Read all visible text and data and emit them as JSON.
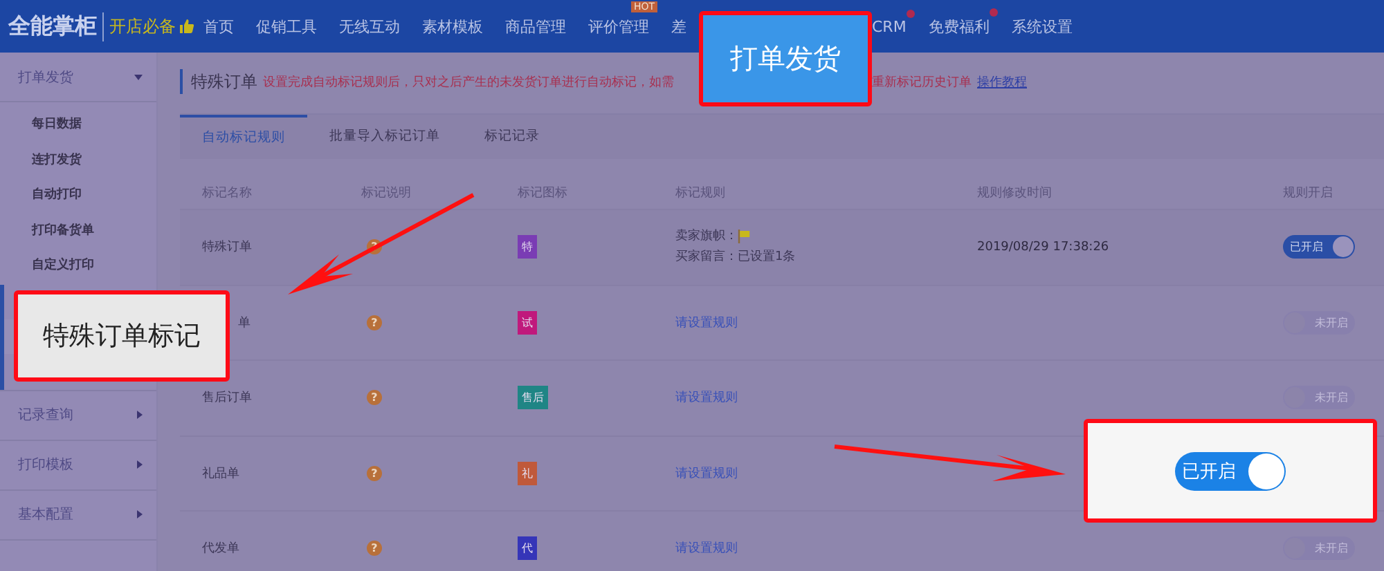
{
  "nav": {
    "logo": "全能掌柜",
    "slogan": "开店必备",
    "items": [
      {
        "label": "首页",
        "dot": false
      },
      {
        "label": "促销工具",
        "dot": false
      },
      {
        "label": "无线互动",
        "dot": false
      },
      {
        "label": "素材模板",
        "dot": false
      },
      {
        "label": "商品管理",
        "dot": false
      },
      {
        "label": "评价管理",
        "badge": "HOT",
        "dot": false
      },
      {
        "label": "差",
        "dot": false
      },
      {
        "label": "CRM",
        "dot": true
      },
      {
        "label": "免费福利",
        "dot": true
      },
      {
        "label": "系统设置",
        "dot": false
      }
    ]
  },
  "sidebar": {
    "sections": [
      {
        "label": "打单发货",
        "expanded": true,
        "children": [
          {
            "label": "每日数据"
          },
          {
            "label": "连打发货"
          },
          {
            "label": "自动打印"
          },
          {
            "label": "打印备货单"
          },
          {
            "label": "自定义打印"
          }
        ]
      },
      {
        "label": "记录查询",
        "expanded": false
      },
      {
        "label": "打印模板",
        "expanded": false
      },
      {
        "label": "基本配置",
        "expanded": false
      }
    ]
  },
  "page": {
    "title": "特殊订单",
    "notice_before": "设置完成自动标记规则后，只对之后产生的未发货订单进行自动标记，如需",
    "notice_after": "重新标记历史订单",
    "link": "操作教程"
  },
  "tabs": [
    {
      "label": "自动标记规则",
      "selected": true
    },
    {
      "label": "批量导入标记订单",
      "selected": false
    },
    {
      "label": "标记记录",
      "selected": false
    }
  ],
  "table": {
    "columns": [
      "标记名称",
      "标记说明",
      "标记图标",
      "标记规则",
      "规则修改时间",
      "规则开启"
    ],
    "rows": [
      {
        "kind": "set",
        "name": "特殊订单",
        "help": "?",
        "icon_text": "特",
        "color": "#7a3cb4",
        "rule": [
          "卖家旗帜：",
          "买家留言：已设置1条"
        ],
        "time": "2019/08/29 17:38:26",
        "on": true,
        "toggle_label": "已开启"
      },
      {
        "kind": "unset",
        "name": "单",
        "help": "?",
        "icon_text": "试",
        "color": "#c0197c",
        "rule": [
          "请设置规则"
        ],
        "on": false,
        "toggle_label": "未开启"
      },
      {
        "kind": "unset",
        "name": "售后订单",
        "help": "?",
        "icon_text": "售后",
        "color": "#1f8585",
        "rule": [
          "请设置规则"
        ],
        "on": false,
        "toggle_label": "未开启"
      },
      {
        "kind": "unset",
        "name": "礼品单",
        "help": "?",
        "icon_text": "礼",
        "color": "#c0593a",
        "rule": [
          "请设置规则"
        ]
      },
      {
        "kind": "unset",
        "name": "代发单",
        "help": "?",
        "icon_text": "代",
        "color": "#3535b8",
        "rule": [
          "请设置规则"
        ],
        "on": false,
        "toggle_label": "未开启"
      }
    ]
  },
  "callouts": [
    {
      "kind": "label",
      "text": "打单发货"
    },
    {
      "kind": "note",
      "text": "特殊订单标记"
    },
    {
      "kind": "toggle",
      "on": true,
      "toggle_label": "已开启"
    }
  ]
}
